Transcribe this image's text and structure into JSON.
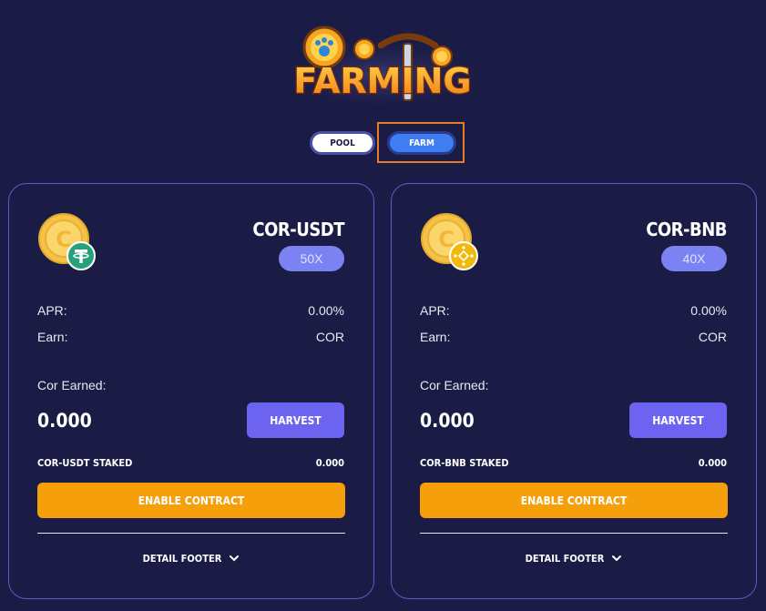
{
  "logo": {
    "text": "FARMING"
  },
  "tabs": [
    {
      "label": "POOL",
      "active": false
    },
    {
      "label": "FARM",
      "active": true
    }
  ],
  "farms": [
    {
      "pair": "COR-USDT",
      "multiplier": "50X",
      "apr_label": "APR:",
      "apr_value": "0.00%",
      "earn_label": "Earn:",
      "earn_value": "COR",
      "earned_label": "Cor Earned:",
      "earned_amount": "0.000",
      "harvest_label": "HARVEST",
      "staked_label": "COR-USDT STAKED",
      "staked_value": "0.000",
      "enable_label": "ENABLE CONTRACT",
      "detail_label": "DETAIL FOOTER",
      "token_icon": "tether-icon"
    },
    {
      "pair": "COR-BNB",
      "multiplier": "40X",
      "apr_label": "APR:",
      "apr_value": "0.00%",
      "earn_label": "Earn:",
      "earn_value": "COR",
      "earned_label": "Cor Earned:",
      "earned_amount": "0.000",
      "harvest_label": "HARVEST",
      "staked_label": "COR-BNB STAKED",
      "staked_value": "0.000",
      "enable_label": "ENABLE CONTRACT",
      "detail_label": "DETAIL FOOTER",
      "token_icon": "bnb-icon"
    }
  ],
  "colors": {
    "background": "#1b1c45",
    "card_border": "#5a5cc6",
    "multiplier_badge": "#7b83f3",
    "harvest_button": "#6c63f0",
    "enable_button": "#f59f0b",
    "farm_tab": "#3f7ef2",
    "highlight_outline": "#e87b26",
    "tether_green": "#26a17b",
    "bnb_yellow": "#f0b90b"
  }
}
